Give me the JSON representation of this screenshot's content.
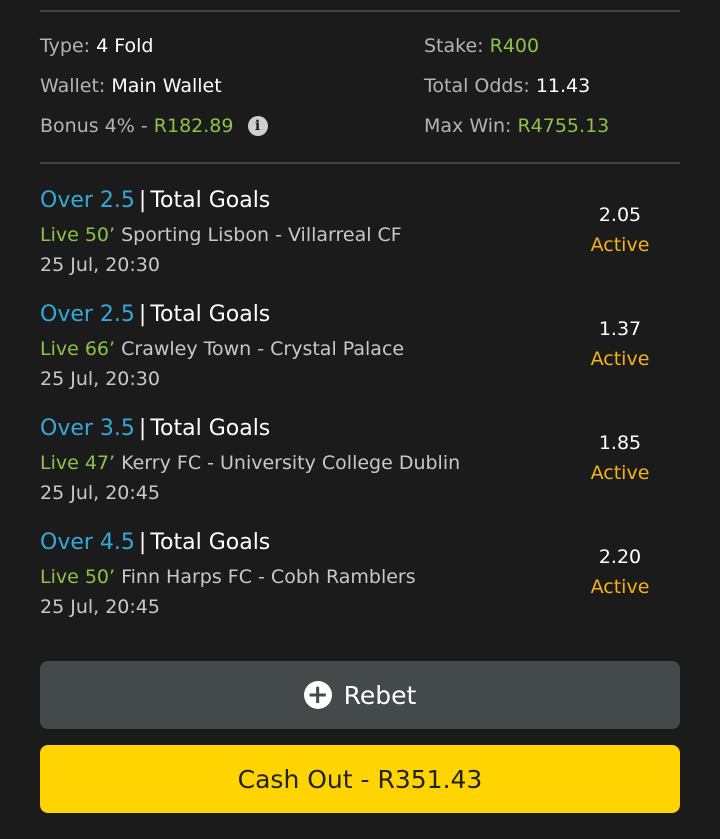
{
  "summary": {
    "type_label": "Type:",
    "type_value": "4 Fold",
    "wallet_label": "Wallet:",
    "wallet_value": "Main Wallet",
    "bonus_label": "Bonus 4% -",
    "bonus_value": "R182.89",
    "stake_label": "Stake:",
    "stake_value": "R400",
    "total_odds_label": "Total Odds:",
    "total_odds_value": "11.43",
    "max_win_label": "Max Win:",
    "max_win_value": "R4755.13"
  },
  "legs": [
    {
      "selection": "Over 2.5",
      "separator": "|",
      "market": "Total Goals",
      "live": "Live 50’",
      "event": "Sporting Lisbon - Villarreal CF",
      "date": "25 Jul, 20:30",
      "odds": "2.05",
      "status": "Active"
    },
    {
      "selection": "Over 2.5",
      "separator": "|",
      "market": "Total Goals",
      "live": "Live 66’",
      "event": "Crawley Town - Crystal Palace",
      "date": "25 Jul, 20:30",
      "odds": "1.37",
      "status": "Active"
    },
    {
      "selection": "Over 3.5",
      "separator": "|",
      "market": "Total Goals",
      "live": "Live 47’",
      "event": "Kerry FC - University College Dublin",
      "date": "25 Jul, 20:45",
      "odds": "1.85",
      "status": "Active"
    },
    {
      "selection": "Over 4.5",
      "separator": "|",
      "market": "Total Goals",
      "live": "Live 50’",
      "event": "Finn Harps FC - Cobh Ramblers",
      "date": "25 Jul, 20:45",
      "odds": "2.20",
      "status": "Active"
    }
  ],
  "actions": {
    "rebet_label": "Rebet",
    "cashout_label": "Cash Out - R351.43"
  },
  "icons": {
    "info": "info-icon",
    "plus": "plus-circle-icon"
  },
  "colors": {
    "accent_green": "#8bc34a",
    "selection_blue": "#35a8d8",
    "status_orange": "#f3b31c",
    "cashout_yellow": "#ffd400"
  }
}
